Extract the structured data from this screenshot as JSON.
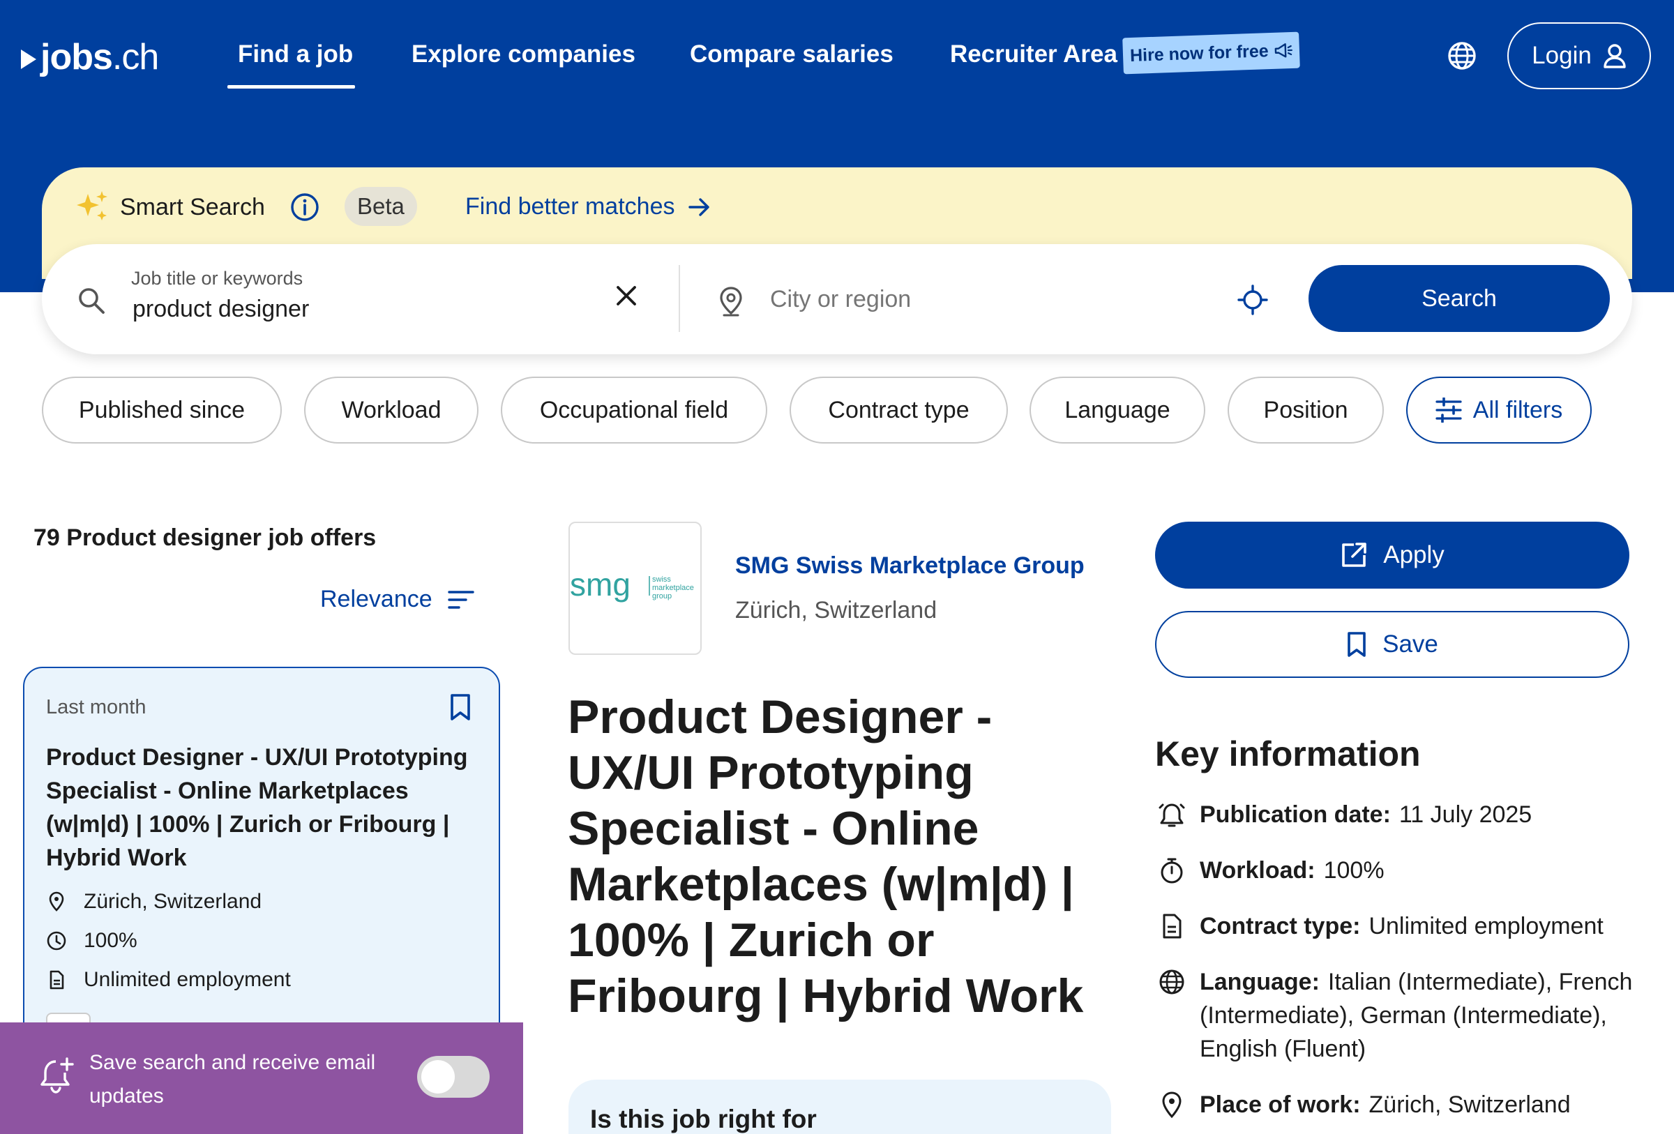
{
  "header": {
    "logo": {
      "prefix": "jobs",
      "dot": ".",
      "suffix": "ch"
    },
    "nav": [
      {
        "label": "Find a job"
      },
      {
        "label": "Explore companies"
      },
      {
        "label": "Compare salaries"
      },
      {
        "label": "Recruiter Area"
      }
    ],
    "hire_badge": "Hire now for free",
    "login_label": "Login",
    "brand_color": "#003f9e"
  },
  "smart_search": {
    "label": "Smart Search",
    "beta": "Beta",
    "better_matches": "Find better matches"
  },
  "search": {
    "keyword_label": "Job title or keywords",
    "keyword_value": "product designer",
    "city_placeholder": "City or region",
    "button_label": "Search"
  },
  "filters": [
    {
      "label": "Published since"
    },
    {
      "label": "Workload"
    },
    {
      "label": "Occupational field"
    },
    {
      "label": "Contract type"
    },
    {
      "label": "Language"
    },
    {
      "label": "Position"
    },
    {
      "label": "All filters"
    }
  ],
  "results": {
    "count_text": "79 Product designer job offers",
    "sort_label": "Relevance"
  },
  "job_card": {
    "date": "Last month",
    "title": "Product Designer - UX/UI Prototyping Specialist - Online Marketplaces (w|m|d) | 100% | Zurich or Fribourg | Hybrid Work",
    "location": "Zürich, Switzerland",
    "workload": "100%",
    "contract": "Unlimited employment"
  },
  "save_toast": {
    "text": "Save search and receive email updates",
    "toggle_on": false,
    "color": "#8e54a1"
  },
  "detail": {
    "company_logo": {
      "mark": "smg",
      "tagline": [
        "swiss",
        "marketplace",
        "group"
      ]
    },
    "company_name": "SMG Swiss Marketplace Group",
    "company_location": "Zürich, Switzerland",
    "title": "Product Designer - UX/UI Prototyping Specialist - Online Marketplaces (w|m|d) | 100% | Zurich or Fribourg | Hybrid Work",
    "fit_title": "Is this job right for",
    "apply_label": "Apply",
    "save_label": "Save"
  },
  "key_info": {
    "title": "Key information",
    "publication_label": "Publication date:",
    "publication_value": "11 July 2025",
    "workload_label": "Workload:",
    "workload_value": "100%",
    "contract_label": "Contract type:",
    "contract_value": "Unlimited employment",
    "language_label": "Language:",
    "language_value": "Italian (Intermediate), French (Intermediate), German (Intermediate), English (Fluent)",
    "place_label": "Place of work:",
    "place_value": "Zürich, Switzerland"
  }
}
